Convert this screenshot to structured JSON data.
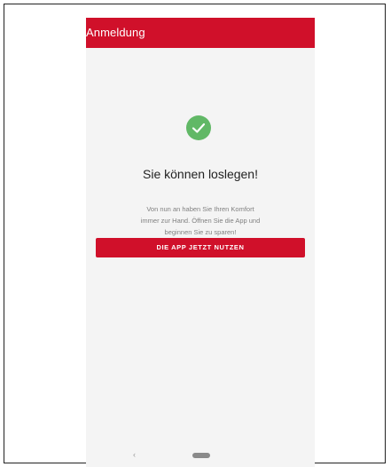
{
  "appbar": {
    "title": "Anmeldung"
  },
  "success": {
    "icon": "checkmark-circle-icon",
    "heading": "Sie können loslegen!",
    "lines": [
      "Von nun an haben Sie Ihren Komfort",
      "immer zur Hand. Öffnen Sie die App und",
      "beginnen Sie zu sparen!"
    ]
  },
  "cta": {
    "label": "DIE APP JETZT NUTZEN"
  },
  "navbar": {
    "back_icon": "back-chevron-icon",
    "home_icon": "home-pill-icon",
    "back_glyph": "‹"
  },
  "colors": {
    "brand": "#d0102a",
    "success": "#61b866",
    "background": "#f4f4f4"
  }
}
